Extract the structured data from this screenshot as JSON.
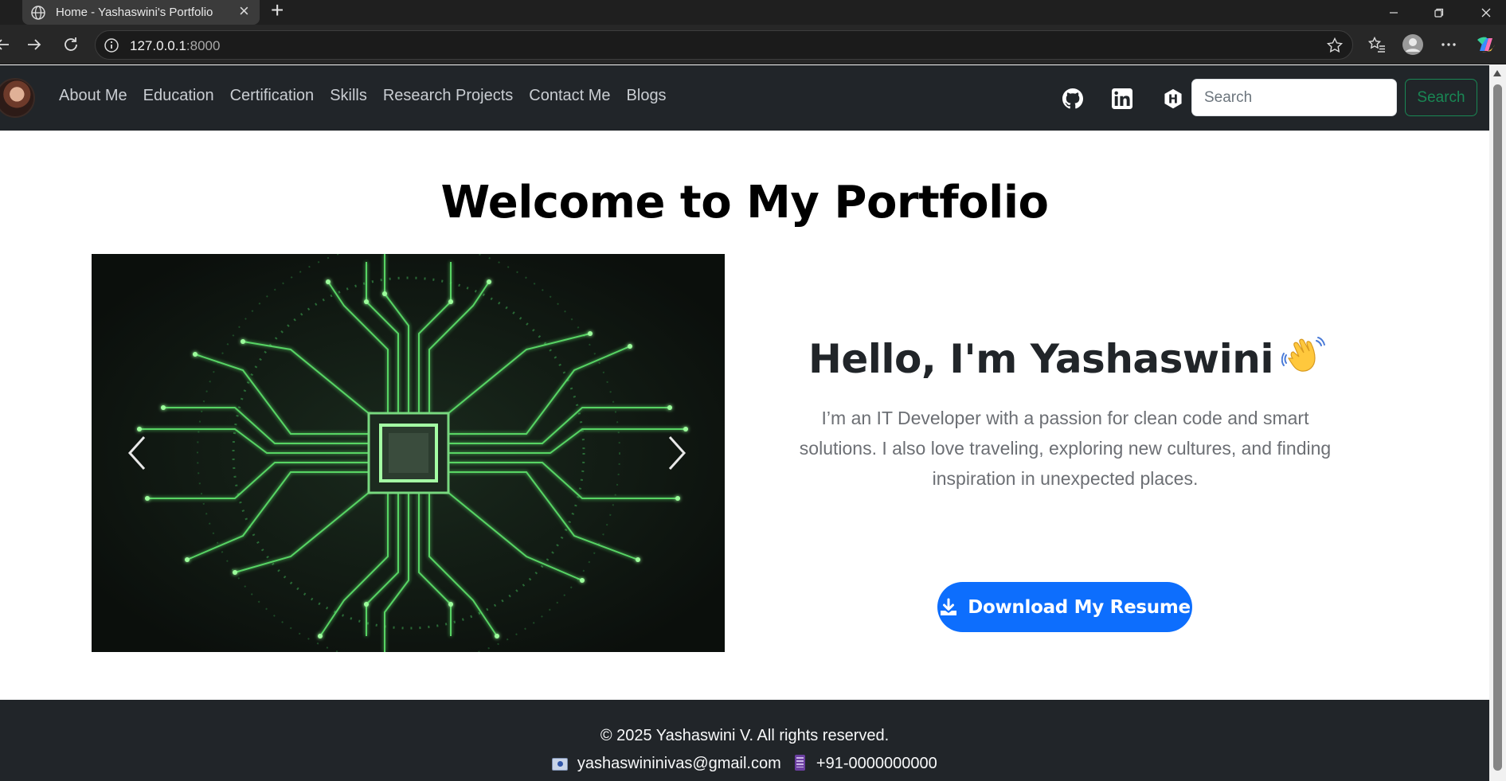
{
  "browser": {
    "tab_title": "Home - Yashaswini's Portfolio",
    "url_host": "127.0.0.1",
    "url_port": ":8000"
  },
  "nav": {
    "links": [
      "About Me",
      "Education",
      "Certification",
      "Skills",
      "Research Projects",
      "Contact Me",
      "Blogs"
    ],
    "search_placeholder": "Search",
    "search_button": "Search",
    "social_icons": [
      "github-icon",
      "linkedin-icon",
      "hashnode-icon"
    ]
  },
  "main": {
    "title": "Welcome to My Portfolio",
    "hello": "Hello, I'm Yashaswini",
    "intro": "I’m an IT Developer with a passion for clean code and smart solutions. I also love traveling, exploring new cultures, and finding inspiration in unexpected places.",
    "resume_button": "Download My Resume"
  },
  "footer": {
    "copyright": "© 2025 Yashaswini V. All rights reserved.",
    "email": "yashaswininivas@gmail.com",
    "phone": "+91-0000000000"
  },
  "colors": {
    "navbar": "#212529",
    "primary": "#0d6efd",
    "success": "#198754",
    "circuit_glow": "#5dff6a"
  }
}
